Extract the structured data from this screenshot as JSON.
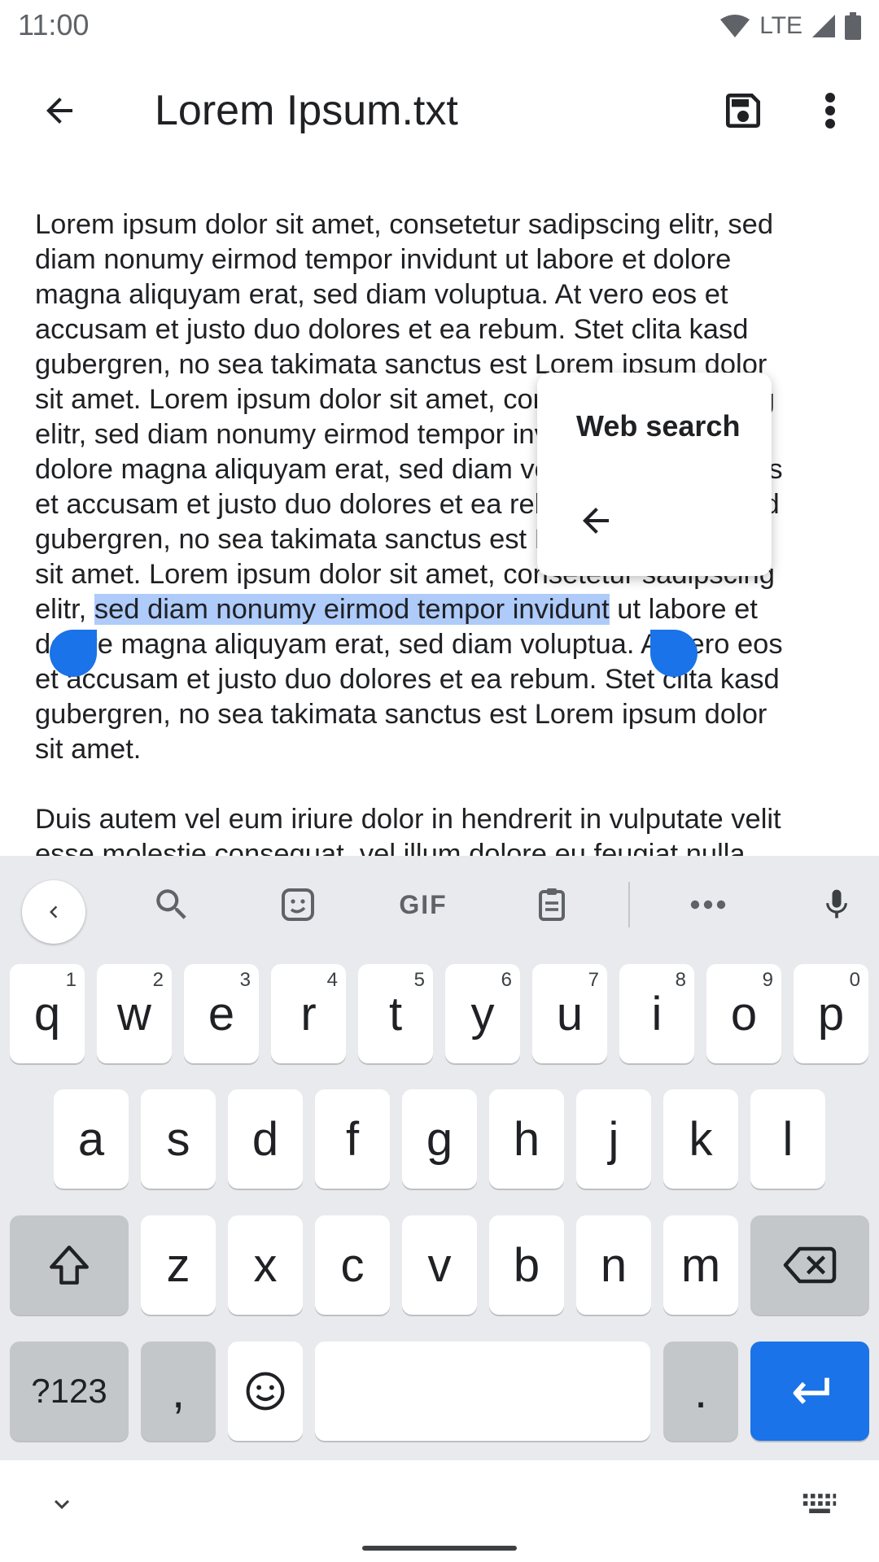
{
  "status_bar": {
    "time": "11:00",
    "network": "LTE"
  },
  "app_bar": {
    "title": "Lorem Ipsum.txt"
  },
  "document": {
    "para1_lines": [
      "Lorem ipsum dolor sit amet, consetetur sadipscing elitr, sed",
      "diam nonumy eirmod tempor invidunt ut labore et dolore",
      "magna aliquyam erat, sed diam voluptua. At vero eos et",
      "accusam et justo duo dolores et ea rebum. Stet clita kasd",
      "gubergren, no sea takimata sanctus est Lorem ipsum dolor",
      "sit amet. Lorem ipsum dolor sit amet, consetetur sadipscing",
      "elitr, sed diam nonumy eirmod tempor invidunt ut labore et",
      "dolore magna aliquyam erat, sed diam voluptua. At vero eos",
      "et accusam et justo duo dolores et ea rebum. Stet clita kasd",
      "gubergren, no sea takimata sanctus est Lorem ipsum dolor",
      "sit amet. Lorem ipsum dolor sit amet, consetetur sadipscing"
    ],
    "selected_line": {
      "before": "elitr, ",
      "selected": "sed diam nonumy eirmod tempor invidunt",
      "after": " ut labore et"
    },
    "para1_tail": [
      "dolore magna aliquyam erat, sed diam voluptua. At vero eos",
      "et accusam et justo duo dolores et ea rebum. Stet clita kasd",
      "gubergren, no sea takimata sanctus est Lorem ipsum dolor",
      "sit amet."
    ],
    "para2_lines": [
      "Duis autem vel eum iriure dolor in hendrerit in vulputate velit",
      "esse molestie consequat, vel illum dolore eu feugiat nulla"
    ]
  },
  "popup": {
    "item": "Web search"
  },
  "keyboard": {
    "toolbar": {
      "gif": "GIF"
    },
    "row1": [
      {
        "k": "q",
        "h": "1"
      },
      {
        "k": "w",
        "h": "2"
      },
      {
        "k": "e",
        "h": "3"
      },
      {
        "k": "r",
        "h": "4"
      },
      {
        "k": "t",
        "h": "5"
      },
      {
        "k": "y",
        "h": "6"
      },
      {
        "k": "u",
        "h": "7"
      },
      {
        "k": "i",
        "h": "8"
      },
      {
        "k": "o",
        "h": "9"
      },
      {
        "k": "p",
        "h": "0"
      }
    ],
    "row2": [
      "a",
      "s",
      "d",
      "f",
      "g",
      "h",
      "j",
      "k",
      "l"
    ],
    "row3": [
      "z",
      "x",
      "c",
      "v",
      "b",
      "n",
      "m"
    ],
    "symbols": "?123",
    "comma": ",",
    "period": "."
  }
}
